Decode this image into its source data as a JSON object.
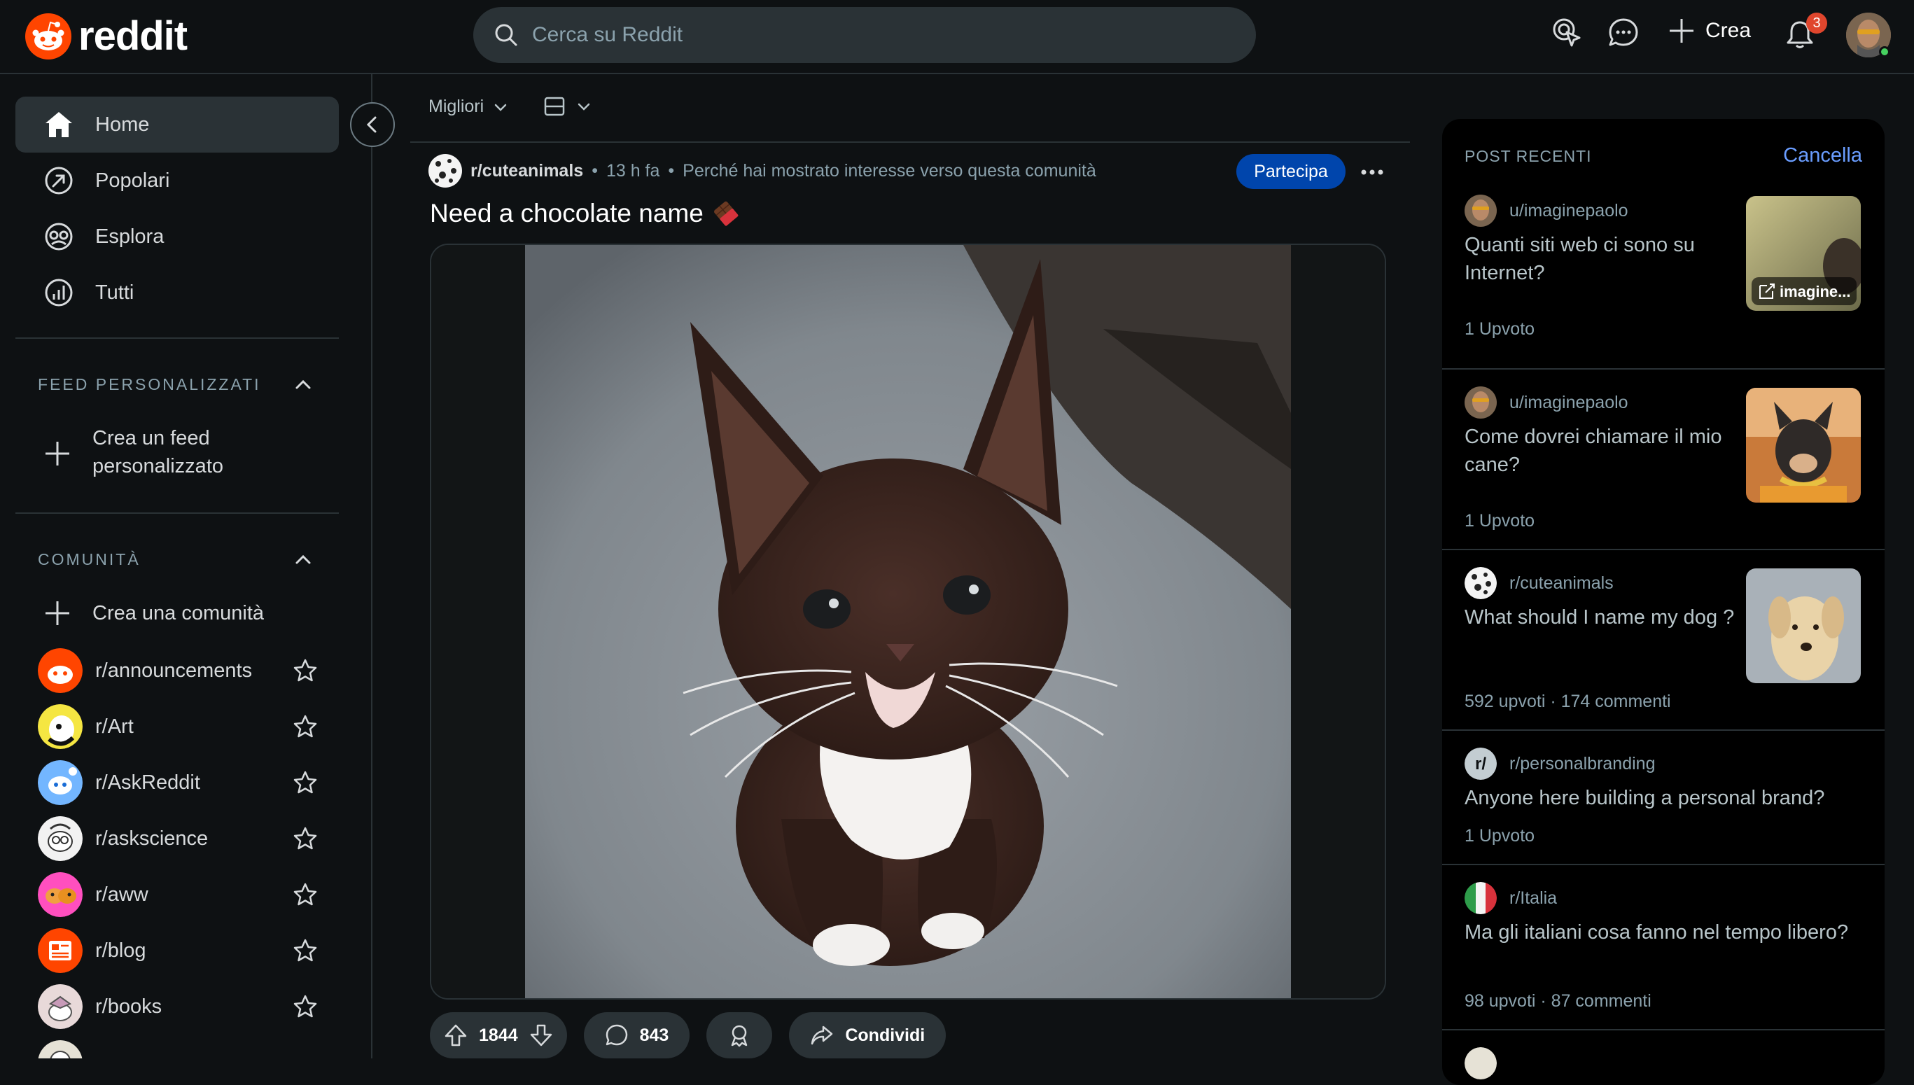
{
  "header": {
    "logo_text": "reddit",
    "search_placeholder": "Cerca su Reddit",
    "create_label": "Crea",
    "notification_count": "3"
  },
  "sidebar": {
    "nav": [
      {
        "label": "Home",
        "icon": "home-icon"
      },
      {
        "label": "Popolari",
        "icon": "popular-icon"
      },
      {
        "label": "Esplora",
        "icon": "explore-icon"
      },
      {
        "label": "Tutti",
        "icon": "all-icon"
      }
    ],
    "custom_feeds": {
      "title": "FEED PERSONALIZZATI",
      "create_label_1": "Crea un feed",
      "create_label_2": "personalizzato"
    },
    "communities": {
      "title": "COMUNITÀ",
      "create_label": "Crea una comunità",
      "items": [
        {
          "name": "r/announcements",
          "color": "#ff4500"
        },
        {
          "name": "r/Art",
          "color": "#f5e642"
        },
        {
          "name": "r/AskReddit",
          "color": "#73b6ff"
        },
        {
          "name": "r/askscience",
          "color": "#f2f2f2"
        },
        {
          "name": "r/aww",
          "color": "#ff4fbf"
        },
        {
          "name": "r/blog",
          "color": "#ff4500"
        },
        {
          "name": "r/books",
          "color": "#e8d9d9"
        }
      ]
    }
  },
  "feed": {
    "sort_label": "Migliori",
    "post": {
      "subreddit": "r/cuteanimals",
      "separator": "•",
      "time": "13 h fa",
      "reason": "Perché hai mostrato interesse verso questa comunità",
      "join_label": "Partecipa",
      "title": "Need a chocolate name",
      "upvotes": "1844",
      "comments": "843",
      "share_label": "Condividi"
    }
  },
  "recent": {
    "title": "POST RECENTI",
    "clear_label": "Cancella",
    "posts": [
      {
        "author": "u/imaginepaolo",
        "title": "Quanti siti web ci sono su Internet?",
        "stats": "1 Upvoto",
        "thumb_label": "imagine..."
      },
      {
        "author": "u/imaginepaolo",
        "title": "Come dovrei chiamare il mio cane?",
        "stats": "1 Upvoto"
      },
      {
        "author": "r/cuteanimals",
        "title": "What should I name my dog ?",
        "stats": "592 upvoti · 174 commenti"
      },
      {
        "author": "r/personalbranding",
        "title": "Anyone here building a personal brand?",
        "stats": "1 Upvoto"
      },
      {
        "author": "r/Italia",
        "title": "Ma gli italiani cosa fanno nel tempo libero?",
        "stats": "98 upvoti · 87 commenti"
      }
    ]
  },
  "colors": {
    "background": "#0e1113",
    "accent_join": "#0045ac",
    "link": "#6a9dff",
    "brand": "#ff4500",
    "badge": "#e0462d"
  }
}
